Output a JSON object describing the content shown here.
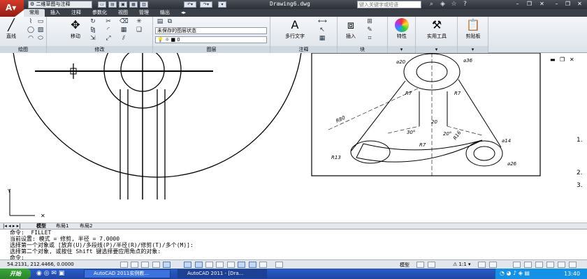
{
  "title_bar": {
    "workspace": "二维草图与注释",
    "document": "Drawing6.dwg",
    "search_placeholder": "键入关键字或短语"
  },
  "ribbon": {
    "tabs": [
      "常用",
      "插入",
      "注释",
      "参数化",
      "视图",
      "管理",
      "输出"
    ],
    "active_tab": "常用",
    "panels": {
      "draw": "绘图",
      "modify": "修改",
      "layer": "图层",
      "annotation": "注释",
      "block": "块"
    },
    "buttons": {
      "line": "直线",
      "move": "移动",
      "multiline_text": "多行文字",
      "insert": "插入",
      "properties": "特性",
      "utilities": "实用工具",
      "clipboard": "剪贴板"
    },
    "layer_state": "未保存的图层状态",
    "layer_current": "0"
  },
  "drawing_dims": [
    "⌀20",
    "⌀36",
    "R7",
    "R80",
    "20",
    "30°",
    "20°",
    "R7",
    "R13",
    "R16",
    "⌀14",
    "⌀26",
    "R7"
  ],
  "side_list": [
    "1.",
    "2.",
    "3."
  ],
  "layout_tabs": [
    "模型",
    "布局1",
    "布局2"
  ],
  "command_lines": [
    "命令:  _FILLET",
    "当前设置: 模式 = 修剪, 半径 = 7.0000",
    "选择第一个对象或 [放弃(U)/多段线(P)/半径(R)/修剪(T)/多个(M)]:",
    "选择第二个对象, 或按住 Shift 键选择要应用角点的对象:",
    "命令:"
  ],
  "status": {
    "coordinates": "54.2131,  212.4466, 0.0000",
    "model": "模型",
    "scale": "1:1"
  },
  "taskbar": {
    "start": "开始",
    "tasks": [
      "AutoCAD 2011实例教...",
      "AutoCAD 2011 - [Dra..."
    ],
    "time": "13:40"
  },
  "colors": {
    "accent": "#c8321f",
    "titlebar": "#2b2f36",
    "taskbar": "#2457c5"
  }
}
